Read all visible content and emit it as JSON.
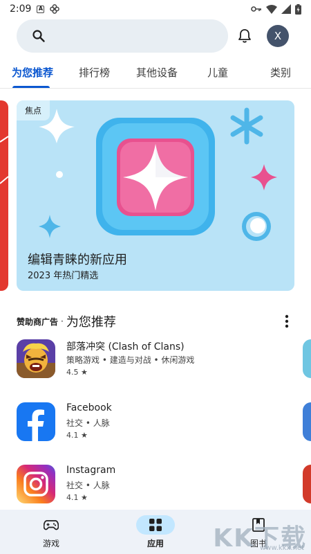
{
  "status_bar": {
    "time": "2:09",
    "box_glyph": "A"
  },
  "search": {
    "placeholder": ""
  },
  "header": {
    "avatar_initial": "X"
  },
  "tabs": [
    {
      "label": "为您推荐",
      "active": true
    },
    {
      "label": "排行榜",
      "active": false
    },
    {
      "label": "其他设备",
      "active": false
    },
    {
      "label": "儿童",
      "active": false
    },
    {
      "label": "类别",
      "active": false
    }
  ],
  "banner": {
    "badge": "焦点",
    "title": "编辑青睐的新应用",
    "subtitle": "2023 年热门精选",
    "background_color": "#b9e3f7"
  },
  "section": {
    "sponsor_label": "赞助商广告",
    "separator": "·",
    "title": "为您推荐"
  },
  "apps": [
    {
      "name": "部落冲突 (Clash of Clans)",
      "categories": "策略游戏 • 建造与对战 • 休闲游戏",
      "rating": "4.5 ★",
      "icon": "clash-of-clans-icon"
    },
    {
      "name": "Facebook",
      "categories": "社交 • 人脉",
      "rating": "4.1 ★",
      "icon": "facebook-icon"
    },
    {
      "name": "Instagram",
      "categories": "社交 • 人脉",
      "rating": "4.1 ★",
      "icon": "instagram-icon"
    }
  ],
  "bottom_nav": [
    {
      "label": "游戏",
      "icon": "gamepad-icon",
      "active": false
    },
    {
      "label": "应用",
      "icon": "apps-grid-icon",
      "active": true
    },
    {
      "label": "图书",
      "icon": "book-icon",
      "active": false
    }
  ],
  "watermark": {
    "text": "KK下载",
    "url": "www.kkx.net"
  },
  "colors": {
    "accent": "#0b57d0",
    "nav_active": "#c2e7ff",
    "search_bg": "#e8eef3"
  }
}
